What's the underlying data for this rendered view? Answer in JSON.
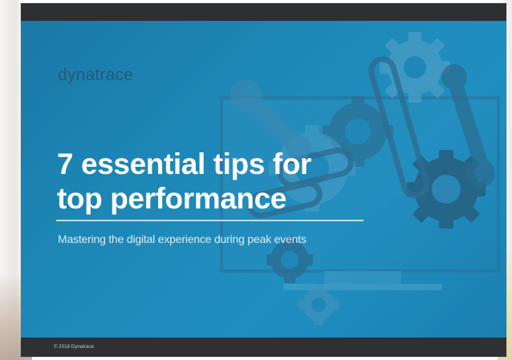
{
  "slide": {
    "brand": "dynatrace",
    "title_line_1": "7 essential tips for",
    "title_line_2": "top performance",
    "subtitle": "Mastering the digital experience during peak events",
    "copyright": "© 2018 Dynatrace"
  },
  "illustration": {
    "icons": [
      "gear-icon",
      "wrench-icon",
      "monitor-icon",
      "chain-link-icon"
    ]
  },
  "colors": {
    "slide_blue": "#1f8fc0",
    "dark_bar": "#2e2f31",
    "illustration_blue": "#4a9dc5",
    "illustration_dark": "#2d6d91",
    "title_text": "#ffffff"
  }
}
